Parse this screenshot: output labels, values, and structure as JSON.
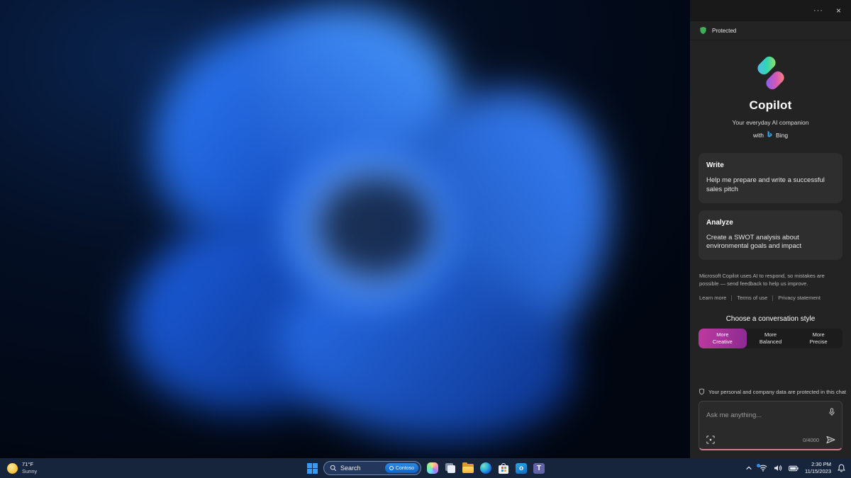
{
  "copilot_panel": {
    "window_controls": {
      "more_glyph": "···",
      "close_glyph": "×"
    },
    "protected_badge": {
      "label": "Protected"
    },
    "hero": {
      "title": "Copilot",
      "subtitle": "Your everyday AI companion",
      "with_label": "with",
      "bing_label": "Bing"
    },
    "suggestion_cards": [
      {
        "title": "Write",
        "body": "Help me prepare and write a successful sales pitch"
      },
      {
        "title": "Analyze",
        "body": "Create a SWOT analysis about environmental goals and impact"
      }
    ],
    "disclaimer": "Microsoft Copilot uses AI to respond, so mistakes are possible — send feedback to help us improve.",
    "footer_links": [
      "Learn more",
      "Terms of use",
      "Privacy statement"
    ],
    "style_chooser": {
      "heading": "Choose a conversation style",
      "options": [
        {
          "line1": "More",
          "line2": "Creative",
          "selected": true
        },
        {
          "line1": "More",
          "line2": "Balanced",
          "selected": false
        },
        {
          "line1": "More",
          "line2": "Precise",
          "selected": false
        }
      ]
    },
    "privacy_note": "Your personal and company data are protected in this chat",
    "composer": {
      "placeholder": "Ask me anything...",
      "char_counter": "0/4000"
    },
    "colors": {
      "style_selected_from": "#bd3a9e",
      "style_selected_to": "#8c2b92",
      "protected_green": "#3fae58",
      "composer_accent": "#cf8090"
    }
  },
  "taskbar": {
    "weather": {
      "temperature": "71°F",
      "condition": "Sunny"
    },
    "search": {
      "label": "Search",
      "badge": "Contoso"
    },
    "apps": [
      "start",
      "copilot",
      "task-view",
      "file-explorer",
      "edge",
      "microsoft-store",
      "outlook",
      "teams"
    ],
    "tray": {
      "time": "2:30 PM",
      "date": "11/15/2023"
    },
    "colors": {
      "taskbar_bg": "#16243c"
    }
  }
}
